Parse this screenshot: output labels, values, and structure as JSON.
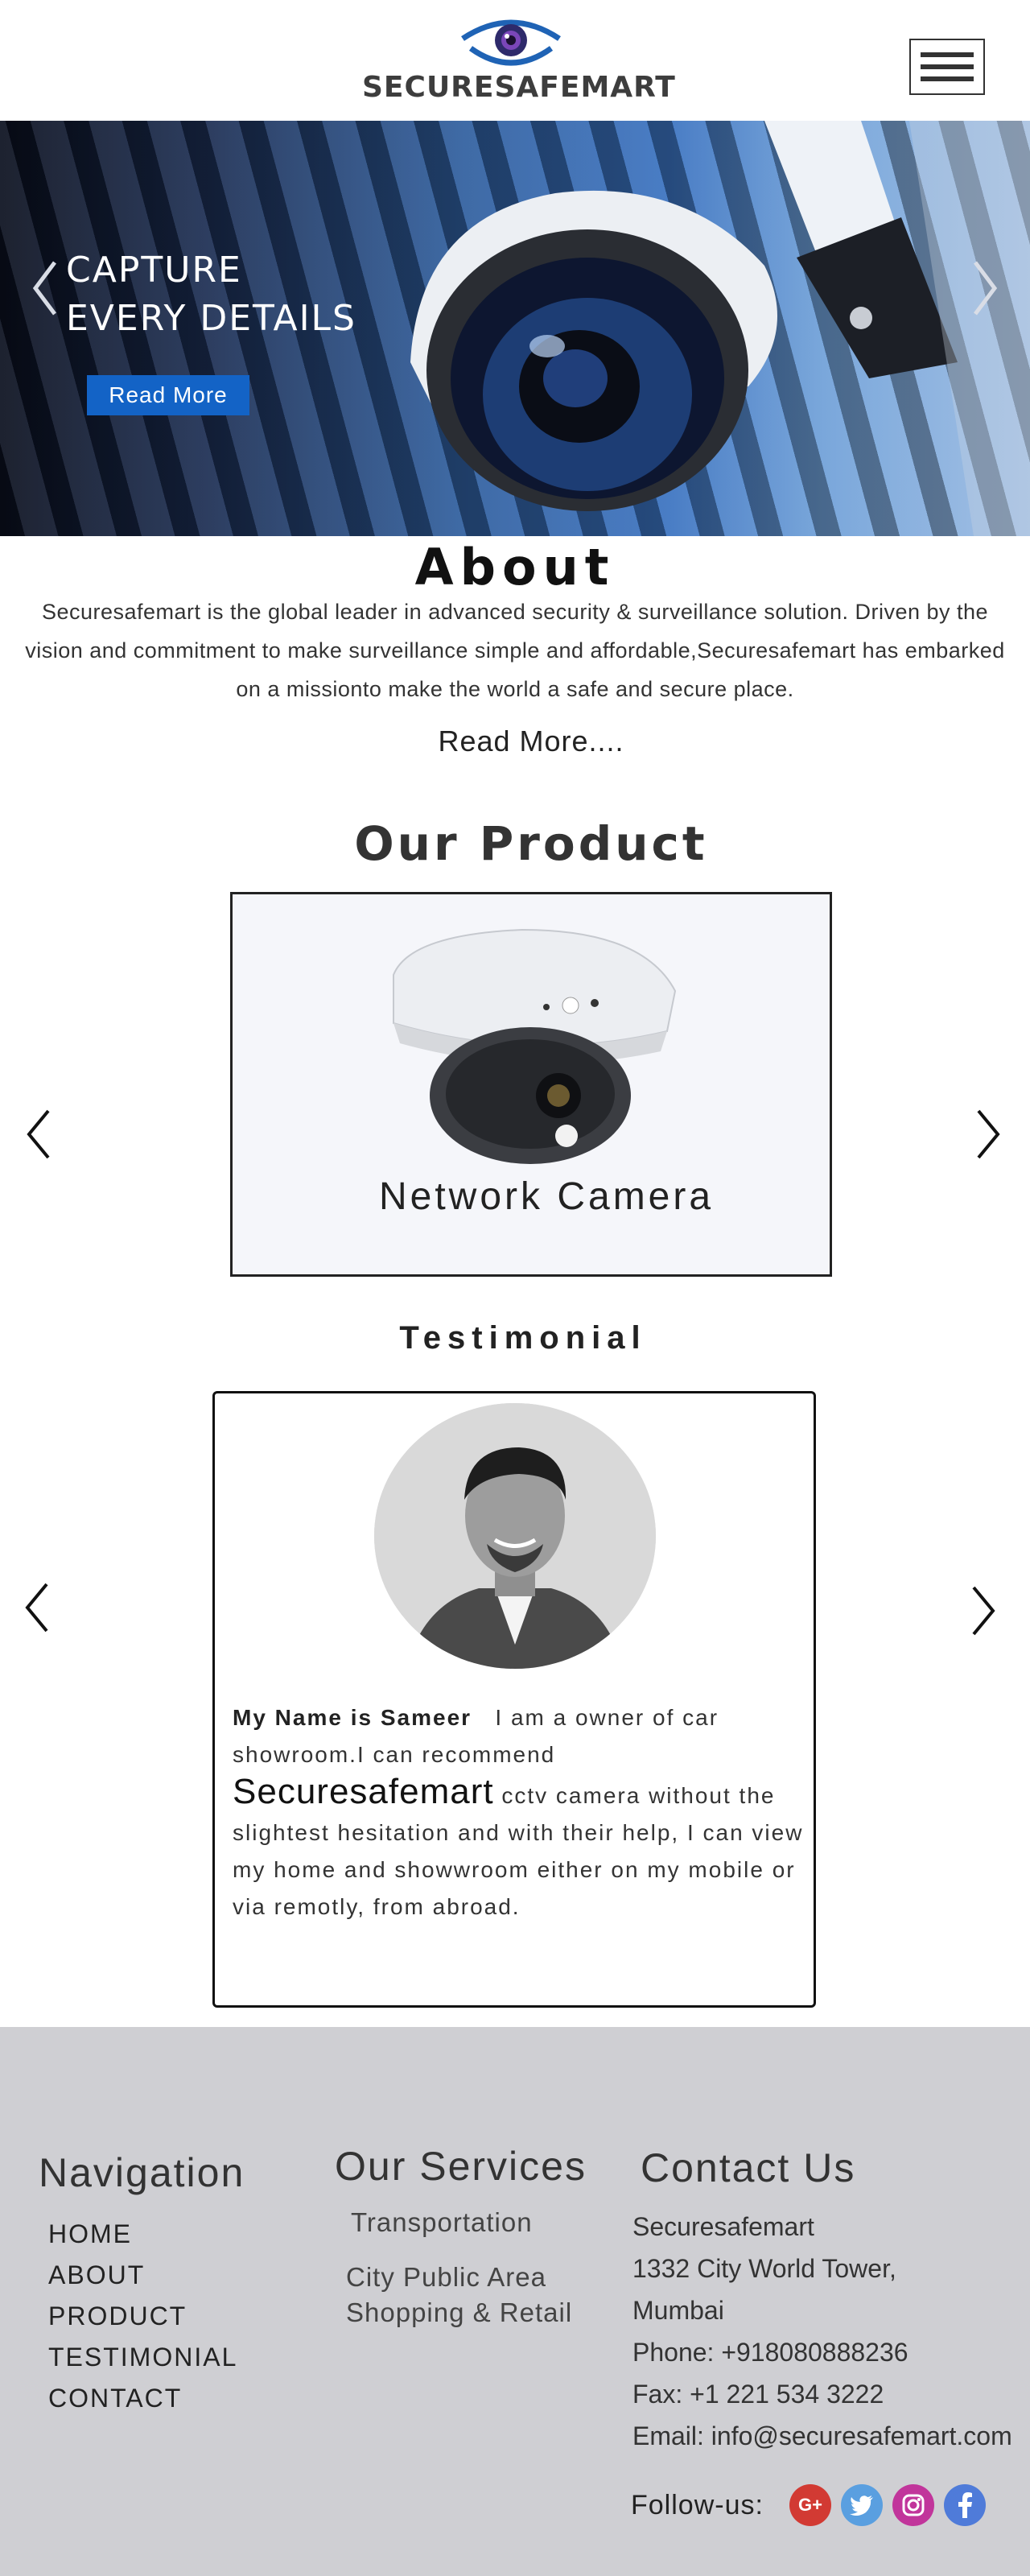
{
  "header": {
    "brand": "SECURESAFEMART",
    "menu_icon": "hamburger-icon"
  },
  "hero": {
    "line1": "CAPTURE",
    "line2": "EVERY DETAILS",
    "button": "Read More"
  },
  "about": {
    "title": "About",
    "text": "Securesafemart is the global leader in advanced security & surveillance solution. Driven by the vision and commitment to make surveillance simple and affordable,Securesafemart has embarked on a missionto make the world a safe and secure place.",
    "read_more": "Read More...."
  },
  "product": {
    "title": "Our Product",
    "items": [
      {
        "name": "Network Camera"
      }
    ]
  },
  "testimonial": {
    "title": "Testimonial",
    "name": "My Name is Sameer",
    "lead": "I am a owner of car showroom.I can recommend",
    "brand": "Securesafemart",
    "rest": "cctv camera  without the slightest hesitation and with their help, I can view my home and showwroom either on my mobile or via remotly, from abroad."
  },
  "footer": {
    "navigation": {
      "title": "Navigation",
      "items": [
        "HOME",
        "ABOUT",
        "PRODUCT",
        "TESTIMONIAL",
        "CONTACT"
      ]
    },
    "services": {
      "title": "Our Services",
      "items": [
        "Transportation",
        "City Public Area",
        "Shopping & Retail"
      ]
    },
    "contact": {
      "title": "Contact Us",
      "company": "Securesafemart",
      "address1": "1332 City World Tower,",
      "address2": "Mumbai",
      "phone": "Phone: +918080888236",
      "fax": "Fax: +1 221 534 3222",
      "email": "Email: info@securesafemart.com"
    },
    "follow": {
      "label": "Follow-us:",
      "gplus": "G+"
    }
  },
  "colors": {
    "accent": "#1363c6",
    "footer_bg": "#cfcfd3",
    "gplus": "#d23a33",
    "twitter": "#5a9fe0",
    "instagram": "#c1359b",
    "facebook": "#4f7bd9"
  }
}
